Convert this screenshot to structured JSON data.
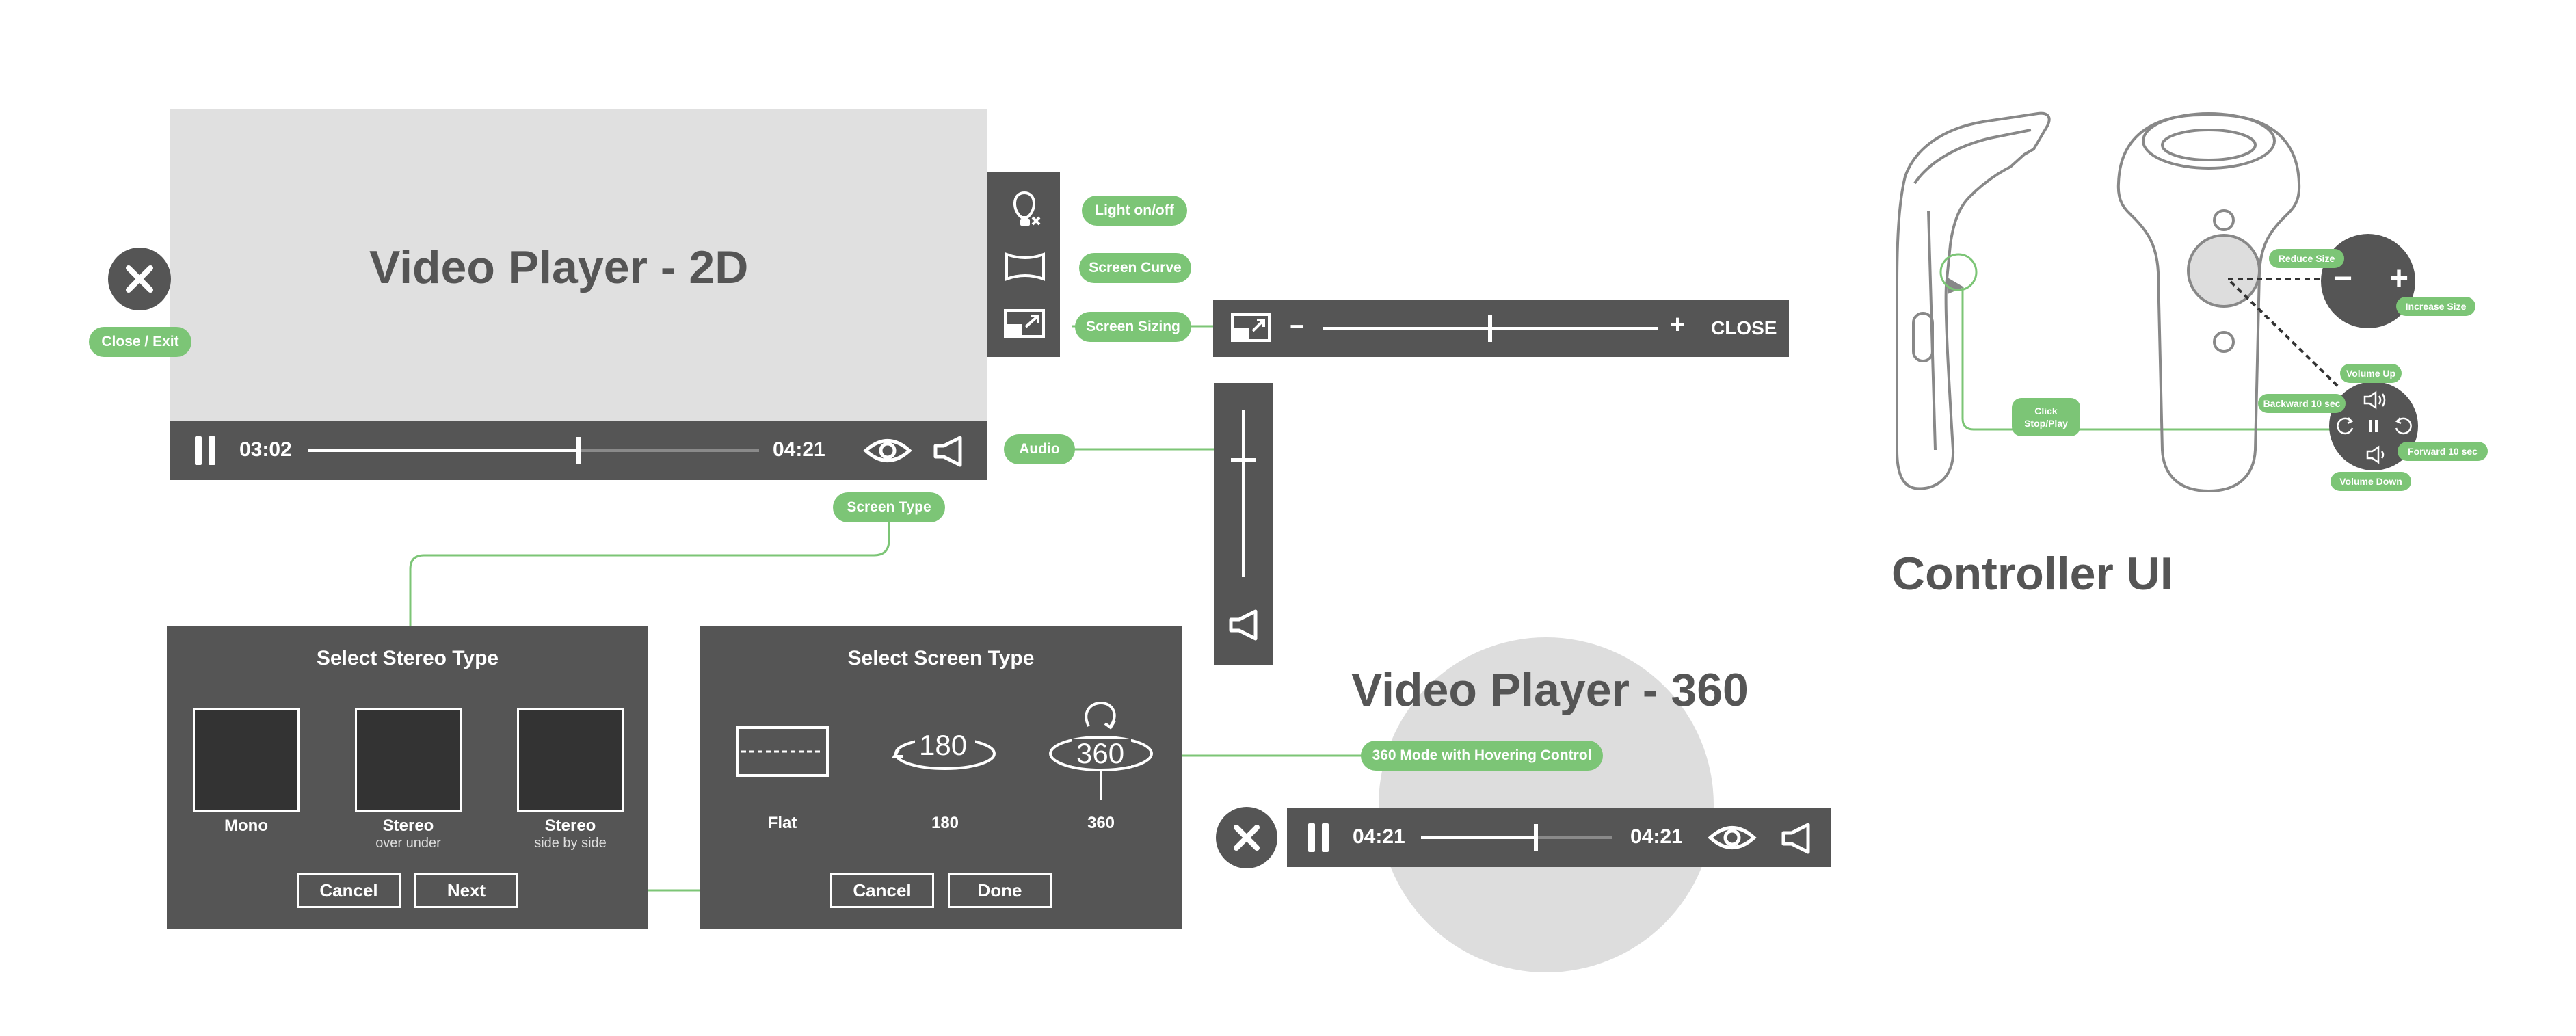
{
  "player2d": {
    "title": "Video Player - 2D",
    "time_current": "03:02",
    "time_total": "04:21",
    "progress": 0.6
  },
  "player360": {
    "title": "Video Player - 360",
    "time_current": "04:21",
    "time_total": "04:21",
    "progress": 0.6
  },
  "labels": {
    "close_exit": "Close / Exit",
    "light": "Light on/off",
    "curve": "Screen Curve",
    "sizing": "Screen Sizing",
    "audio": "Audio",
    "screen_type": "Screen Type",
    "mode360": "360 Mode with Hovering Control"
  },
  "sizing_bar": {
    "minus": "−",
    "plus": "+",
    "close": "CLOSE",
    "level": 0.5
  },
  "audio_level": 0.7,
  "stereo_dialog": {
    "title": "Select Stereo Type",
    "options": [
      {
        "label": "Mono",
        "sub": ""
      },
      {
        "label": "Stereo",
        "sub": "over under"
      },
      {
        "label": "Stereo",
        "sub": "side by side"
      }
    ],
    "cancel": "Cancel",
    "next": "Next"
  },
  "screen_dialog": {
    "title": "Select Screen Type",
    "options": [
      {
        "label": "Flat",
        "icon": "flat-screen-icon"
      },
      {
        "label": "180",
        "icon": "180-icon",
        "glyph": "180"
      },
      {
        "label": "360",
        "icon": "360-icon",
        "glyph": "360"
      }
    ],
    "cancel": "Cancel",
    "done": "Done"
  },
  "controller": {
    "title": "Controller UI",
    "click": "Click\nStop/Play",
    "reduce": "Reduce Size",
    "increase": "Increase Size",
    "vol_up": "Volume Up",
    "vol_down": "Volume Down",
    "backward": "Backward 10 sec",
    "forward": "Forward 10 sec",
    "minus": "−",
    "plus": "+"
  },
  "colors": {
    "panel": "#555555",
    "accent": "#7cc576",
    "screen": "#e0e0e0"
  }
}
